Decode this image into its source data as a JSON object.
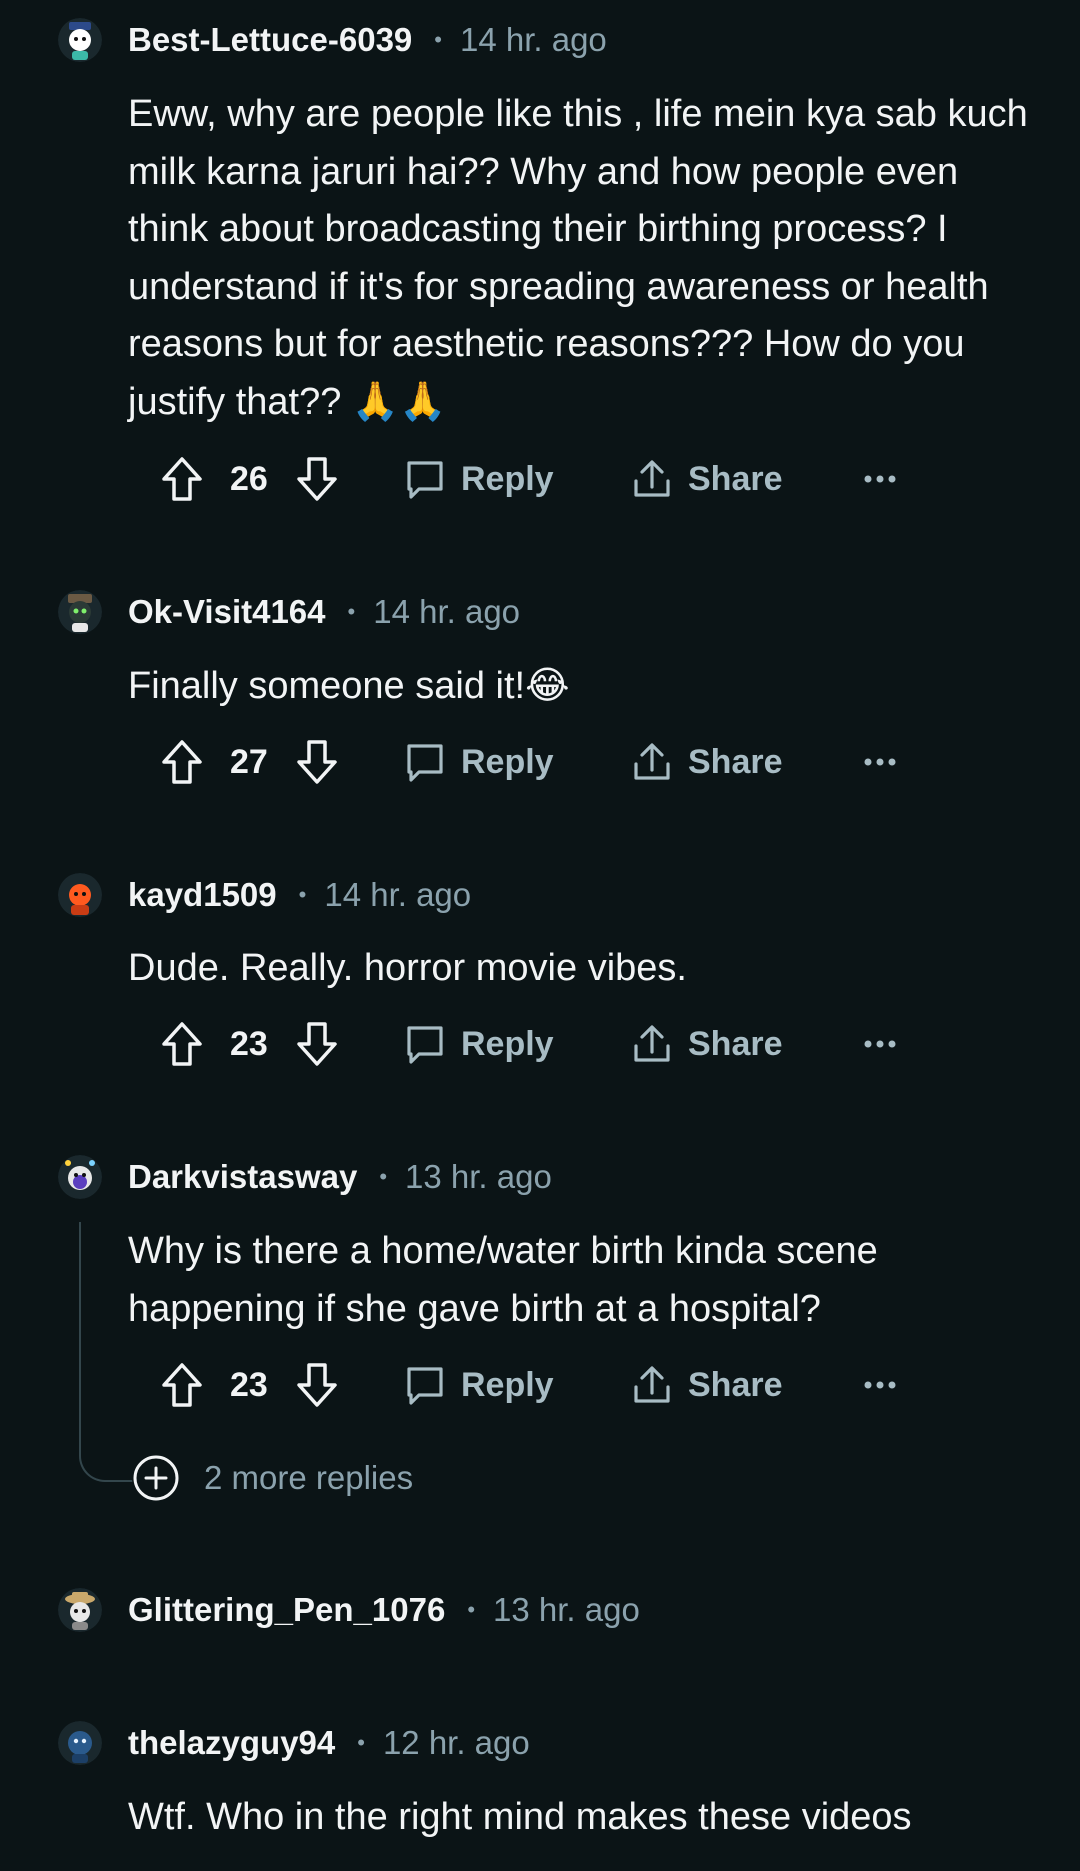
{
  "comments": [
    {
      "username": "Best-Lettuce-6039",
      "time": "14 hr. ago",
      "body": "Eww, why are people like this , life mein kya sab kuch milk karna jaruri hai?? Why and how people even think about broadcasting their birthing process? I understand if it's for spreading awareness or health reasons but for aesthetic reasons??? How do you justify that?? 🙏🙏",
      "votes": "26",
      "reply_label": "Reply",
      "share_label": "Share"
    },
    {
      "username": "Ok-Visit4164",
      "time": "14 hr. ago",
      "body": "Finally someone said it!😂",
      "votes": "27",
      "reply_label": "Reply",
      "share_label": "Share"
    },
    {
      "username": "kayd1509",
      "time": "14 hr. ago",
      "body": "Dude. Really. horror movie vibes.",
      "votes": "23",
      "reply_label": "Reply",
      "share_label": "Share"
    },
    {
      "username": "Darkvistasway",
      "time": "13 hr. ago",
      "body": "Why is there a home/water birth kinda scene happening if she gave birth at a hospital?",
      "votes": "23",
      "reply_label": "Reply",
      "share_label": "Share",
      "more_replies": "2 more replies"
    },
    {
      "username": "Glittering_Pen_1076",
      "time": "13 hr. ago"
    },
    {
      "username": "thelazyguy94",
      "time": "12 hr. ago",
      "body": "Wtf. Who in the right mind makes these videos"
    }
  ],
  "separator": "•",
  "icons": {
    "upvote": "arrow-up-icon",
    "downvote": "arrow-down-icon",
    "reply": "speech-bubble-icon",
    "share": "share-icon",
    "more": "ellipsis-icon",
    "expand": "plus-circle-icon"
  },
  "colors": {
    "background": "#0b1416",
    "text": "#f2f4f5",
    "muted": "#8ba2ad",
    "action": "#a8bcc4"
  }
}
